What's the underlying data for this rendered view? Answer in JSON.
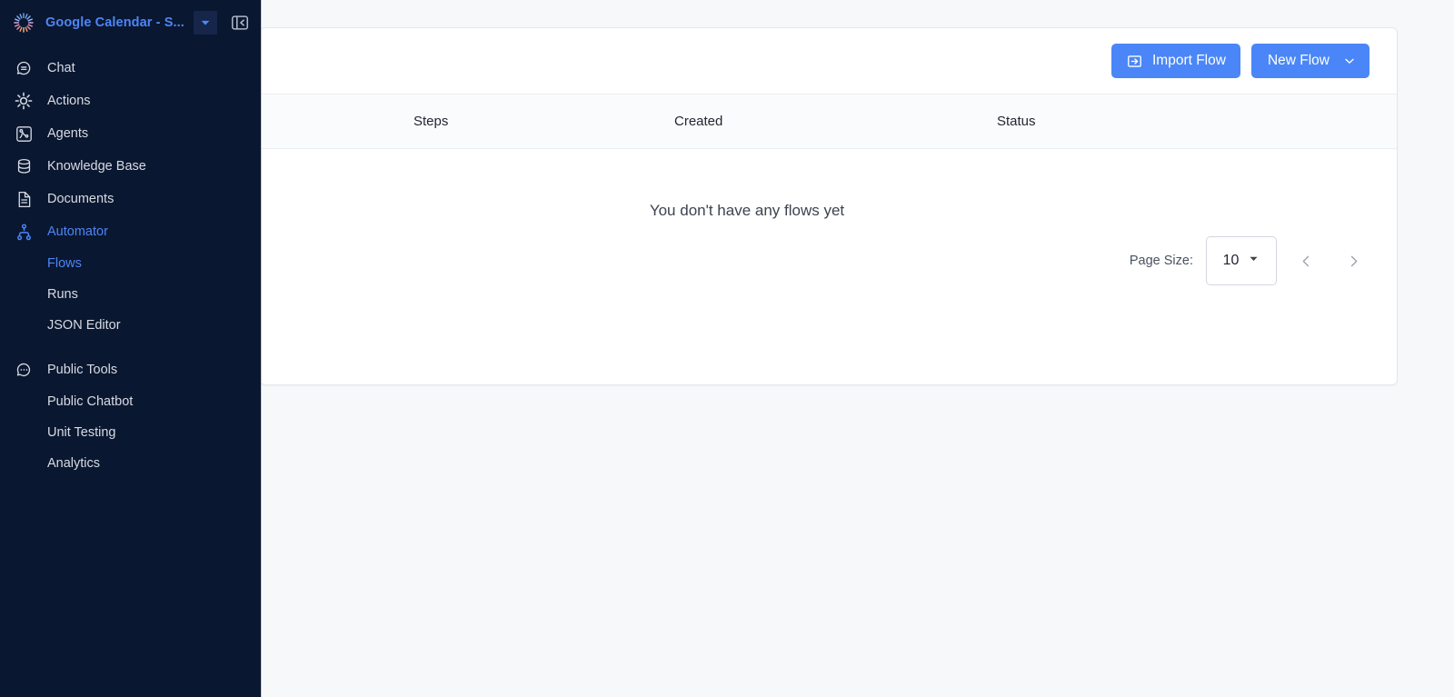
{
  "sidebar": {
    "brand": {
      "name": "Google Calendar - S...",
      "logo_icon": "burst-logo-icon",
      "caret_icon": "caret-down-icon",
      "collapse_icon": "panel-collapse-icon"
    },
    "items": [
      {
        "label": "Chat",
        "icon": "chat-bubble-icon",
        "active": false,
        "sub": false
      },
      {
        "label": "Actions",
        "icon": "gear-sun-icon",
        "active": false,
        "sub": false
      },
      {
        "label": "Agents",
        "icon": "agents-node-icon",
        "active": false,
        "sub": false
      },
      {
        "label": "Knowledge Base",
        "icon": "database-icon",
        "active": false,
        "sub": false
      },
      {
        "label": "Documents",
        "icon": "document-icon",
        "active": false,
        "sub": false
      },
      {
        "label": "Automator",
        "icon": "hierarchy-icon",
        "active": true,
        "sub": false
      },
      {
        "label": "Flows",
        "icon": null,
        "active": true,
        "sub": true
      },
      {
        "label": "Runs",
        "icon": null,
        "active": false,
        "sub": true
      },
      {
        "label": "JSON Editor",
        "icon": null,
        "active": false,
        "sub": true
      },
      {
        "label": "Public Tools",
        "icon": "chat-dots-icon",
        "active": false,
        "sub": false
      },
      {
        "label": "Public Chatbot",
        "icon": null,
        "active": false,
        "sub": true
      },
      {
        "label": "Unit Testing",
        "icon": null,
        "active": false,
        "sub": true
      },
      {
        "label": "Analytics",
        "icon": null,
        "active": false,
        "sub": true
      }
    ]
  },
  "toolbar": {
    "import_label": "Import Flow",
    "import_icon": "import-arrow-icon",
    "new_label": "New Flow",
    "new_caret_icon": "chevron-down-icon"
  },
  "table": {
    "columns": [
      "",
      "Steps",
      "Created",
      "Status"
    ],
    "rows": [],
    "empty_message": "You don't have any flows yet"
  },
  "pagination": {
    "page_size_label": "Page Size:",
    "page_size_value": "10",
    "page_size_caret_icon": "caret-down-icon",
    "prev_icon": "chevron-left-icon",
    "next_icon": "chevron-right-icon"
  },
  "colors": {
    "sidebar_bg": "#0a1730",
    "accent_blue": "#4a86f7",
    "active_text": "#4d86f7",
    "main_bg": "#f7f8fa",
    "card_bg": "#ffffff"
  }
}
